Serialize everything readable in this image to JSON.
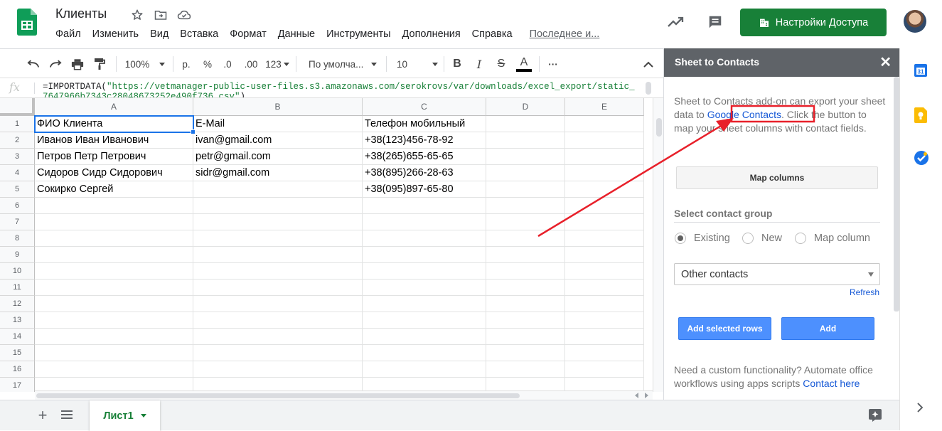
{
  "doc": {
    "title": "Клиенты"
  },
  "menu": {
    "items": [
      "Файл",
      "Изменить",
      "Вид",
      "Вставка",
      "Формат",
      "Данные",
      "Инструменты",
      "Дополнения",
      "Справка"
    ],
    "last_edit": "Последнее и..."
  },
  "share_button": {
    "label": "Настройки Доступа"
  },
  "toolbar": {
    "zoom": "100%",
    "currency": "р.",
    "percent": "%",
    "decrease_decimal": ".0",
    "increase_decimal": ".00",
    "more_formats": "123",
    "font": "По умолча...",
    "font_size": "10",
    "bold": "B",
    "italic": "I",
    "strike": "S",
    "text_color": "A",
    "more": "···"
  },
  "formula": {
    "prefix": "=IMPORTDATA(",
    "string": "\"https://vetmanager-public-user-files.s3.amazonaws.com/serokrovs/var/downloads/excel_export/static_7647966b7343c28048673252e490f736.csv\"",
    "suffix": ")"
  },
  "grid": {
    "columns": [
      "A",
      "B",
      "C",
      "D",
      "E"
    ],
    "row_numbers": [
      "1",
      "2",
      "3",
      "4",
      "5",
      "6",
      "7",
      "8",
      "9",
      "10",
      "11",
      "12",
      "13",
      "14",
      "15",
      "16",
      "17"
    ],
    "rows": [
      [
        "ФИО Клиента",
        "E-Mail",
        "Телефон мобильный",
        "",
        ""
      ],
      [
        "Иванов Иван Иванович",
        "ivan@gmail.com",
        "+38(123)456-78-92",
        "",
        ""
      ],
      [
        "Петров Петр Петрович",
        "petr@gmail.com",
        "+38(265)655-65-65",
        "",
        ""
      ],
      [
        "Сидоров Сидр Сидорович",
        "sidr@gmail.com",
        "+38(895)266-28-63",
        "",
        ""
      ],
      [
        "Сокирко Сергей",
        "",
        "+38(095)897-65-80",
        "",
        ""
      ]
    ]
  },
  "sheet_tab": {
    "label": "Лист1"
  },
  "panel": {
    "title": "Sheet to Contacts",
    "desc_before": "Sheet to Contacts add-on can export your sheet data to ",
    "desc_link": "Google Contacts",
    "desc_after": ". Click the button to map your sheet columns with contact fields.",
    "map_button": "Map columns",
    "group_title": "Select contact group",
    "radio_existing": "Existing",
    "radio_new": "New",
    "radio_map": "Map column",
    "selected_group": "Other contacts",
    "refresh": "Refresh",
    "add_selected": "Add selected rows",
    "add": "Add",
    "footer_text": "Need a custom functionality? Automate office workflows using apps scripts ",
    "footer_link": "Contact here"
  },
  "colors": {
    "accent_green": "#188038",
    "link_blue": "#1558d6",
    "primary_button": "#4d90fe",
    "annotation_red": "#e8202a"
  }
}
